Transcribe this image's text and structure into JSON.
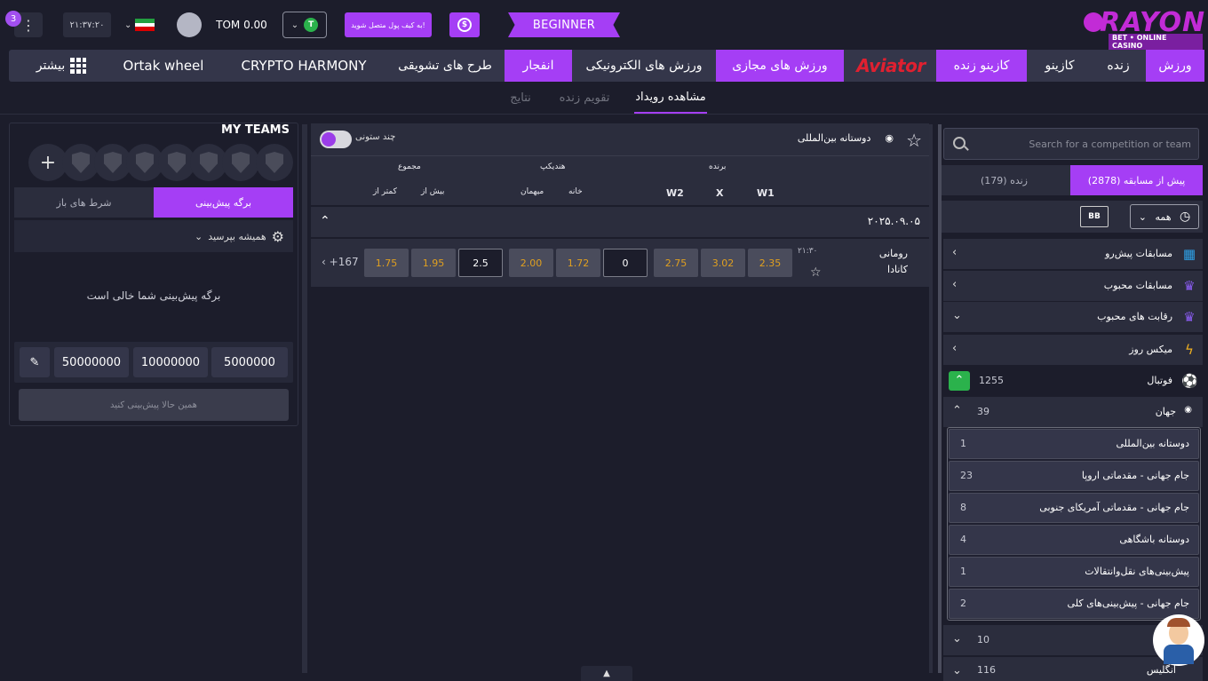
{
  "header": {
    "notif_count": "3",
    "time": "۲۱:۳۷:۲۰",
    "balance": "TOM 0.00",
    "t_badge": "T",
    "wallet_label": "به کیف پول متصل شوید!",
    "dollar_symbol": "$",
    "level": "BEGINNER",
    "logo_text": "RAYON",
    "logo_sub": "BET • ONLINE CASINO"
  },
  "nav": {
    "sports": "ورزش",
    "live": "زنده",
    "casino": "کازینو",
    "live_casino": "کازینو زنده",
    "aviator": "Aviator",
    "virtual": "ورزش های مجازی",
    "esports": "ورزش های الکترونیکی",
    "explosion": "انفجار",
    "promotions": "طرح های تشویقی",
    "crypto": "CRYPTO HARMONY",
    "ortak": "Ortak wheel",
    "more": "بیشتر"
  },
  "subnav": {
    "event_view": "مشاهده رویداد",
    "live_calendar": "تقویم زنده",
    "results": "نتایج"
  },
  "left": {
    "my_teams": "MY TEAMS",
    "tab_betslip": "برگه پیش‌بینی",
    "tab_open": "شرط های باز",
    "accept_odds": "همیشه بپرسید",
    "empty": "برگه پیش‌بینی شما خالی است",
    "stakes": [
      "5000000",
      "10000000",
      "50000000"
    ],
    "place_bet": "همین حالا پیش‌بینی کنید"
  },
  "center": {
    "multi_column": "چند ستونی",
    "competition": "دوستانه بین‌المللی",
    "headers": {
      "winner": "برنده",
      "handicap": "هندیکپ",
      "total": "مجموع",
      "w1": "W1",
      "x": "X",
      "w2": "W2",
      "home": "خانه",
      "away": "میهمان",
      "over": "بیش از",
      "under": "کمتر از"
    },
    "date": "۲۰۲۵.۰۹.۰۵",
    "match": {
      "team1": "رومانی",
      "team2": "کانادا",
      "time": "۲۱:۳۰",
      "w1": "2.35",
      "x": "3.02",
      "w2": "2.75",
      "hcp_line": "0",
      "hcp_home": "1.72",
      "hcp_away": "2.00",
      "total_line": "2.5",
      "over": "1.95",
      "under": "1.75",
      "more": "+167"
    }
  },
  "right": {
    "search_placeholder": "Search for a competition or team",
    "tab_prematch": "پیش از مسابقه (2878)",
    "tab_live": "زنده (179)",
    "bb": "BB",
    "all": "همه",
    "upcoming": "مسابقات پیش‌رو",
    "popular": "مسابقات محبوب",
    "popular_comp": "رقابت های محبوب",
    "day_mix": "میکس روز",
    "football": "فوتبال",
    "football_count": "1255",
    "world": "جهان",
    "world_count": "39",
    "subs": [
      {
        "name": "دوستانه بین‌المللی",
        "count": "1"
      },
      {
        "name": "جام جهانی - مقدماتی اروپا",
        "count": "23"
      },
      {
        "name": "جام جهانی - مقدماتی آمریکای جنوبی",
        "count": "8"
      },
      {
        "name": "دوستانه باشگاهی",
        "count": "4"
      },
      {
        "name": "پیش‌بینی‌های نقل‌وانتقالات",
        "count": "1"
      },
      {
        "name": "جام جهانی - پیش‌بینی‌های کلی",
        "count": "2"
      }
    ],
    "next_count": "10",
    "last_name": "انگلیس",
    "last_count": "116"
  },
  "colors": {
    "accent": "#a53ef5",
    "bg": "#1c1d2b",
    "panel": "#2b2d3d",
    "odds": "#e0a020"
  }
}
